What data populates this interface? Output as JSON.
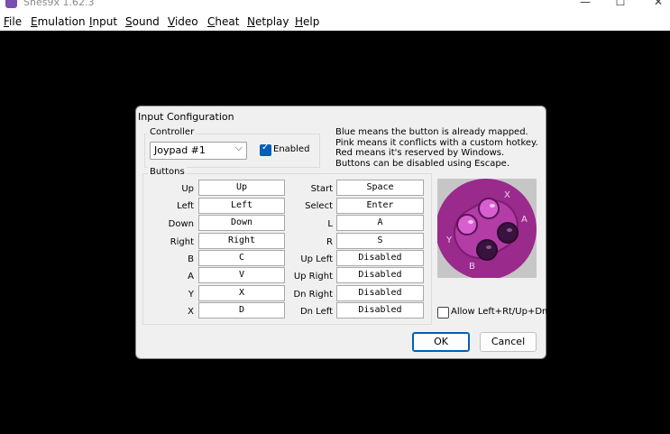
{
  "window": {
    "title": "Snes9x 1.62.3",
    "minimize_glyph": "—",
    "maximize_glyph": "☐",
    "close_glyph": "✕"
  },
  "menu": {
    "items": [
      {
        "mn": "F",
        "rest": "ile"
      },
      {
        "mn": "E",
        "rest": "mulation"
      },
      {
        "mn": "I",
        "rest": "nput"
      },
      {
        "mn": "S",
        "rest": "ound"
      },
      {
        "mn": "V",
        "rest": "ideo"
      },
      {
        "mn": "C",
        "rest": "heat"
      },
      {
        "mn": "N",
        "rest": "etplay"
      },
      {
        "mn": "H",
        "rest": "elp"
      }
    ]
  },
  "dialog": {
    "title": "Input Configuration",
    "controller": {
      "group_label": "Controller",
      "selected": "Joypad #1",
      "dropdown_glyph": "⌵",
      "enabled_label": "Enabled",
      "enabled_checked": true
    },
    "info_lines": [
      "Blue means the button is already mapped.",
      "Pink means it conflicts with a custom hotkey.",
      "Red means it's reserved by Windows.",
      "Buttons can be disabled using Escape."
    ],
    "buttons_group_label": "Buttons",
    "left_bindings": [
      {
        "label": "Up",
        "value": "Up"
      },
      {
        "label": "Left",
        "value": "Left"
      },
      {
        "label": "Down",
        "value": "Down"
      },
      {
        "label": "Right",
        "value": "Right"
      },
      {
        "label": "B",
        "value": "C"
      },
      {
        "label": "A",
        "value": "V"
      },
      {
        "label": "Y",
        "value": "X"
      },
      {
        "label": "X",
        "value": "D"
      }
    ],
    "right_bindings": [
      {
        "label": "Start",
        "value": "Space"
      },
      {
        "label": "Select",
        "value": "Enter"
      },
      {
        "label": "L",
        "value": "A"
      },
      {
        "label": "R",
        "value": "S"
      },
      {
        "label": "Up Left",
        "value": "Disabled"
      },
      {
        "label": "Up Right",
        "value": "Disabled"
      },
      {
        "label": "Dn Right",
        "value": "Disabled"
      },
      {
        "label": "Dn Left",
        "value": "Disabled"
      }
    ],
    "pad_image": {
      "letters": {
        "x": "X",
        "a": "A",
        "y": "Y",
        "b": "B"
      },
      "colors": {
        "body": "#9a2a8c",
        "face_buttons_light": "#d85fd0",
        "face_buttons_dark": "#3a1240",
        "background": "#c6c6c6"
      }
    },
    "allow_diagonals": {
      "label": "Allow Left+Rt/Up+Dn",
      "checked": false
    },
    "ok_label": "OK",
    "cancel_label": "Cancel"
  }
}
